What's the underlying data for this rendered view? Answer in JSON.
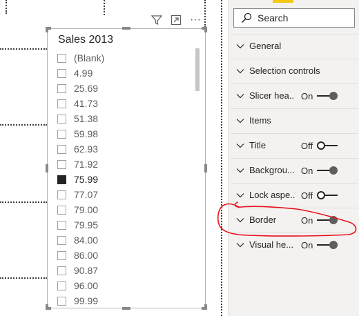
{
  "slicer": {
    "title": "Sales 2013",
    "items": [
      {
        "label": "(Blank)",
        "checked": false
      },
      {
        "label": "4.99",
        "checked": false
      },
      {
        "label": "25.69",
        "checked": false
      },
      {
        "label": "41.73",
        "checked": false
      },
      {
        "label": "51.38",
        "checked": false
      },
      {
        "label": "59.98",
        "checked": false
      },
      {
        "label": "62.93",
        "checked": false
      },
      {
        "label": "71.92",
        "checked": false
      },
      {
        "label": "75.99",
        "checked": true
      },
      {
        "label": "77.07",
        "checked": false
      },
      {
        "label": "79.00",
        "checked": false
      },
      {
        "label": "79.95",
        "checked": false
      },
      {
        "label": "84.00",
        "checked": false
      },
      {
        "label": "86.00",
        "checked": false
      },
      {
        "label": "90.87",
        "checked": false
      },
      {
        "label": "96.00",
        "checked": false
      },
      {
        "label": "99.99",
        "checked": false
      }
    ]
  },
  "visual_header": {
    "icons": [
      "filter-icon",
      "focus-mode-icon",
      "more-options-icon"
    ],
    "more_glyph": "···"
  },
  "format_pane": {
    "search": {
      "label": "Search"
    },
    "sections": [
      {
        "label": "General",
        "toggle": null
      },
      {
        "label": "Selection controls",
        "toggle": null
      },
      {
        "label": "Slicer hea...",
        "toggle": "On"
      },
      {
        "label": "Items",
        "toggle": null
      },
      {
        "label": "Title",
        "toggle": "Off"
      },
      {
        "label": "Backgrou...",
        "toggle": "On"
      },
      {
        "label": "Lock aspe...",
        "toggle": "Off"
      },
      {
        "label": "Border",
        "toggle": "On"
      },
      {
        "label": "Visual he...",
        "toggle": "On"
      }
    ]
  },
  "colors": {
    "accent": "#f2c811",
    "annotation": "#e8121c",
    "checked_box": "#252423"
  }
}
